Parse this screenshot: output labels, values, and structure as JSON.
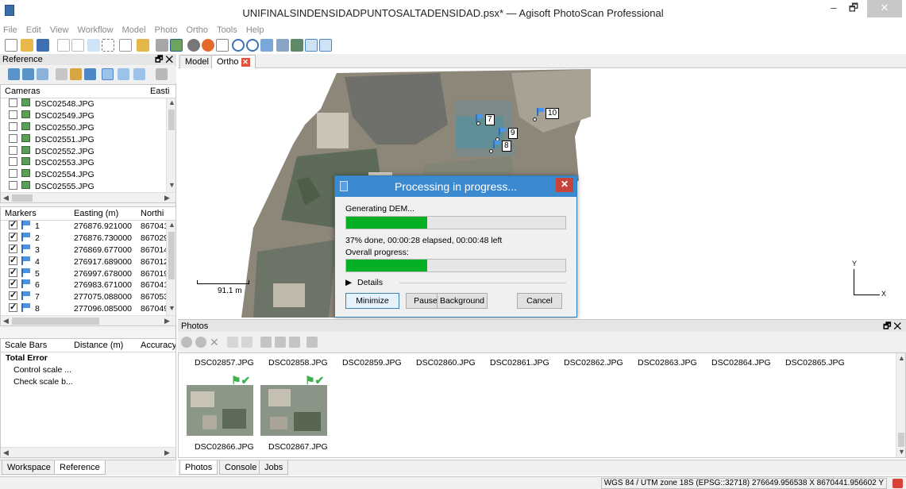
{
  "window": {
    "title": "UNIFINALSINDENSIDADPUNTOSALTADENSIDAD.psx* — Agisoft PhotoScan Professional",
    "minimize": "–",
    "restore": "🗗",
    "close": "✕"
  },
  "menu": [
    "File",
    "Edit",
    "View",
    "Workflow",
    "Model",
    "Photo",
    "Ortho",
    "Tools",
    "Help"
  ],
  "reference_panel": {
    "title": "Reference",
    "float_close": "🗗 ✕",
    "cameras": {
      "headers": [
        "Cameras",
        "Easti"
      ],
      "items": [
        "DSC02548.JPG",
        "DSC02549.JPG",
        "DSC02550.JPG",
        "DSC02551.JPG",
        "DSC02552.JPG",
        "DSC02553.JPG",
        "DSC02554.JPG",
        "DSC02555.JPG"
      ]
    },
    "markers": {
      "headers": [
        "Markers",
        "Easting (m)",
        "Northi"
      ],
      "rows": [
        {
          "name": "1",
          "easting": "276876.921000",
          "northing": "867041"
        },
        {
          "name": "2",
          "easting": "276876.730000",
          "northing": "867029"
        },
        {
          "name": "3",
          "easting": "276869.677000",
          "northing": "867014"
        },
        {
          "name": "4",
          "easting": "276917.689000",
          "northing": "867012"
        },
        {
          "name": "5",
          "easting": "276997.678000",
          "northing": "867019"
        },
        {
          "name": "6",
          "easting": "276983.671000",
          "northing": "867041"
        },
        {
          "name": "7",
          "easting": "277075.088000",
          "northing": "867053"
        },
        {
          "name": "8",
          "easting": "277096.085000",
          "northing": "867049"
        }
      ]
    },
    "scalebars": {
      "headers": [
        "Scale Bars",
        "Distance (m)",
        "Accuracy"
      ],
      "items": [
        "Total Error",
        "Control scale ...",
        "Check scale b..."
      ]
    },
    "bottom_tabs": [
      "Workspace",
      "Reference"
    ]
  },
  "view_tabs": [
    "Model",
    "Ortho"
  ],
  "ortho_view": {
    "markers": [
      "7",
      "9",
      "8",
      "10"
    ],
    "scale_label": "91.1 m",
    "axis_y": "Y",
    "axis_x": "X"
  },
  "dialog": {
    "title": "Processing in progress...",
    "close": "✕",
    "task": "Generating DEM...",
    "task_progress": 0.37,
    "status": "37% done, 00:00:28 elapsed, 00:00:48 left",
    "overall_label": "Overall progress:",
    "overall_progress": 0.37,
    "details_label": "Details",
    "buttons": [
      "Minimize",
      "Pause",
      "Background",
      "Cancel"
    ]
  },
  "photos_panel": {
    "title": "Photos",
    "float_close": "🗗 ✕",
    "row1": [
      "DSC02857.JPG",
      "DSC02858.JPG",
      "DSC02859.JPG",
      "DSC02860.JPG",
      "DSC02861.JPG",
      "DSC02862.JPG",
      "DSC02863.JPG",
      "DSC02864.JPG",
      "DSC02865.JPG"
    ],
    "row2": [
      "DSC02866.JPG",
      "DSC02867.JPG"
    ],
    "bottom_tabs": [
      "Photos",
      "Console",
      "Jobs"
    ]
  },
  "status_bar": {
    "coords": "WGS 84 / UTM zone 18S (EPSG::32718)  276649.956538 X  8670441.956602 Y"
  }
}
